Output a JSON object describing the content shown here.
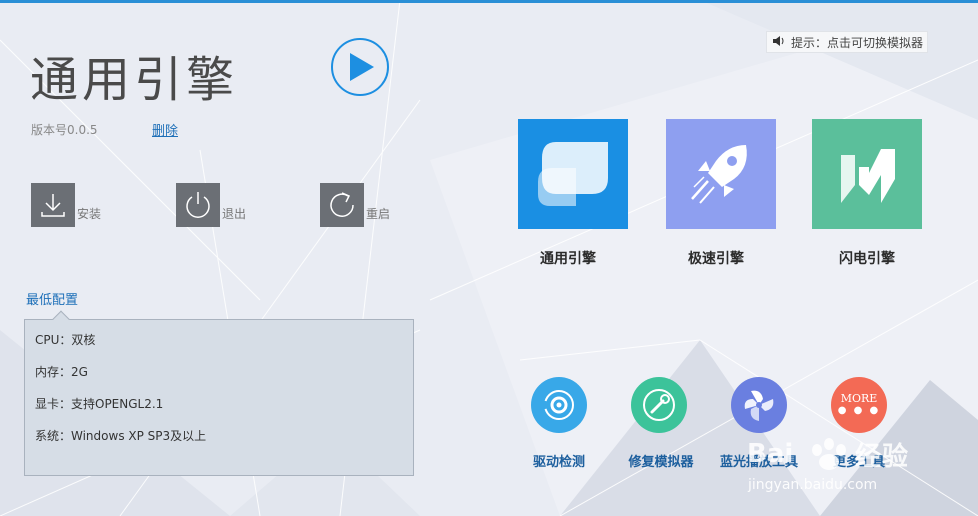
{
  "left_panel": {
    "title": "通用引擎",
    "version": "版本号0.0.5",
    "delete_label": "删除",
    "actions": [
      {
        "label": "安装",
        "icon": "download-icon"
      },
      {
        "label": "退出",
        "icon": "power-icon"
      },
      {
        "label": "重启",
        "icon": "restart-icon"
      }
    ],
    "min_config": {
      "label": "最低配置",
      "lines": [
        "CPU：双核",
        "内存：2G",
        "显卡：支持OPENGL2.1",
        "系统：Windows XP SP3及以上"
      ]
    }
  },
  "hint": {
    "icon": "speaker-icon",
    "text": "提示：点击可切换模拟器"
  },
  "engines": [
    {
      "name": "通用引擎",
      "color": "#1a8fe3",
      "icon": "leaf-icon"
    },
    {
      "name": "极速引擎",
      "color": "#8e9ff0",
      "icon": "rocket-icon"
    },
    {
      "name": "闪电引擎",
      "color": "#5bbf9b",
      "icon": "lightning-icon"
    }
  ],
  "tools": [
    {
      "label": "驱动检测",
      "color": "#38a8e8",
      "icon": "gear-icon"
    },
    {
      "label": "修复模拟器",
      "color": "#3cc39a",
      "icon": "wrench-icon"
    },
    {
      "label": "蓝光播放工具",
      "color": "#6a7fe0",
      "icon": "fan-icon"
    },
    {
      "label": "更多工具",
      "color": "#f36a55",
      "icon": "more-icon",
      "badge": "MORE"
    }
  ],
  "watermark": {
    "brand": "Baidu",
    "text": "经验",
    "url": "jingyan.baidu.com"
  }
}
